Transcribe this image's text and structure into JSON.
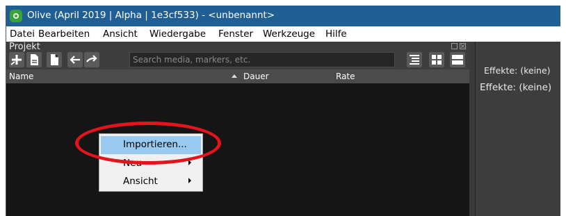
{
  "window": {
    "title": "Olive (April 2019 | Alpha | 1e3cf533) - <unbenannt>"
  },
  "menubar": {
    "items": [
      "Datei",
      "Bearbeiten",
      "Ansicht",
      "Wiedergabe",
      "Fenster",
      "Werkzeuge",
      "Hilfe"
    ]
  },
  "project_panel": {
    "title": "Projekt",
    "toolbar_icons": [
      "add-icon",
      "new-file-icon",
      "open-file-icon",
      "undo-icon",
      "redo-icon",
      "list-view-icon",
      "icon-view-icon",
      "tree-view-icon"
    ],
    "search": {
      "placeholder": "Search media, markers, etc.",
      "value": ""
    },
    "columns": [
      "Name",
      "Dauer",
      "Rate"
    ]
  },
  "context_menu": {
    "items": [
      {
        "label": "Importieren...",
        "highlighted": true,
        "submenu": false
      },
      {
        "label": "Neu",
        "highlighted": false,
        "submenu": true
      },
      {
        "label": "Ansicht",
        "highlighted": false,
        "submenu": true
      }
    ]
  },
  "effects_panel": {
    "header_label": "Effekte: (keine)",
    "body_label": "Effekte: (keine)"
  },
  "colors": {
    "titlebar": "#1f5f93",
    "highlight": "#99c9ef",
    "annotation": "#e3141b"
  }
}
